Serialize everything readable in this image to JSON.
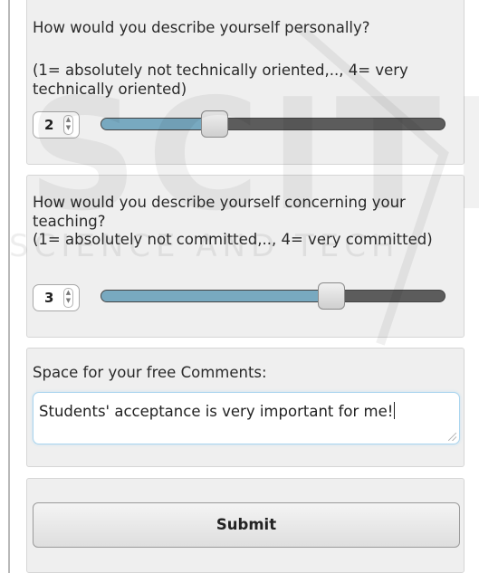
{
  "questions": [
    {
      "prompt": "How would you describe yourself personally?",
      "scale": "(1= absolutely not technically oriented,.., 4= very technically oriented)",
      "value": "2",
      "level": 0.33
    },
    {
      "prompt": "How would you describe yourself concerning your teaching?",
      "scale": "(1= absolutely not committed,.., 4= very committed)",
      "value": "3",
      "level": 0.67
    }
  ],
  "comments": {
    "label": "Space for your free Comments:",
    "value": "Students' acceptance is very important for me!"
  },
  "submit_label": "Submit",
  "watermark": {
    "brand": "SCITE",
    "tagline": "SCIENCE AND TECH"
  },
  "colors": {
    "slider_fill": "#78a9c0",
    "slider_track": "#5c5c5c",
    "panel_bg": "#efefef",
    "focus_border": "#a9d4ee"
  },
  "icons": [
    "spin-arrows-icon",
    "resize-grip-icon"
  ]
}
